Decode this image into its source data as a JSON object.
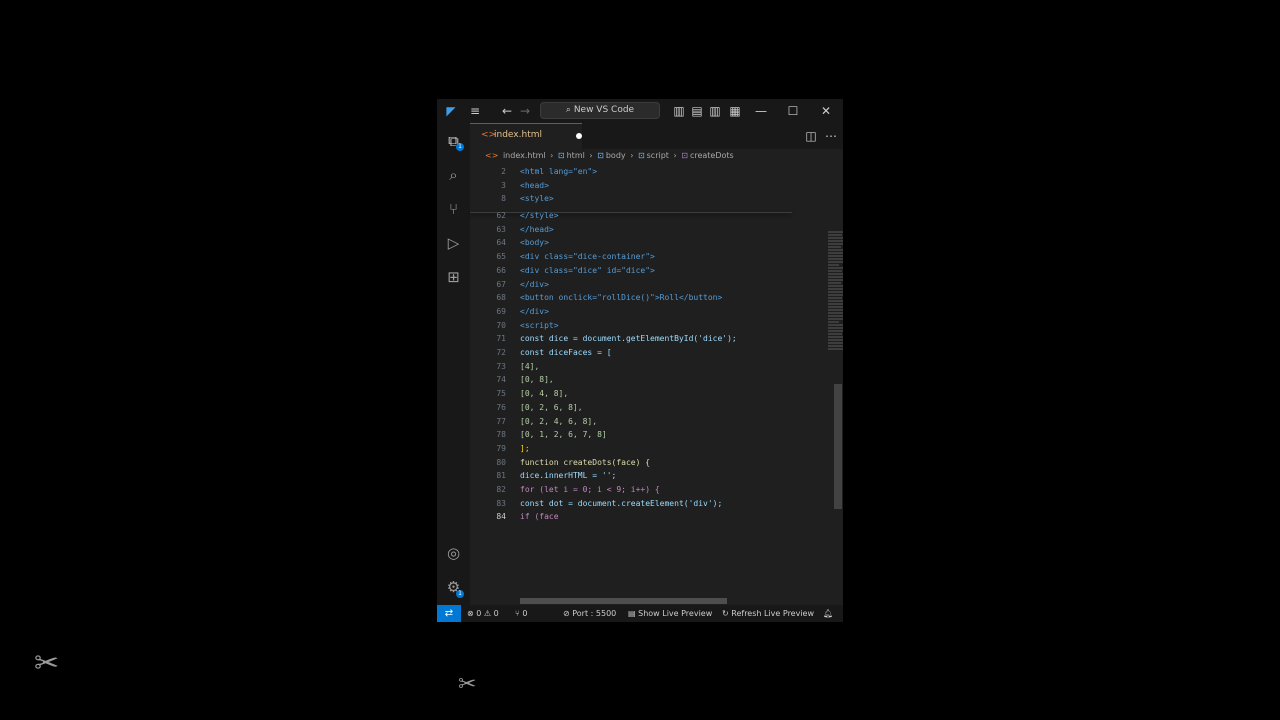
{
  "titlebar": {
    "search_label": "New VS Code"
  },
  "tab": {
    "label": "index.html"
  },
  "breadcrumb": [
    "index.html",
    "html",
    "body",
    "script",
    "createDots"
  ],
  "sticky_lines": [
    {
      "n": "2",
      "t": "<html lang=\"en\">"
    },
    {
      "n": "3",
      "t": "<head>"
    },
    {
      "n": "8",
      "t": "<style>"
    }
  ],
  "code_lines": [
    {
      "n": "62",
      "t": "</style>"
    },
    {
      "n": "63",
      "t": "</head>"
    },
    {
      "n": "64",
      "t": "<body>"
    },
    {
      "n": "65",
      "t": "<div class=\"dice-container\">"
    },
    {
      "n": "66",
      "t": "<div class=\"dice\" id=\"dice\">"
    },
    {
      "n": "67",
      "t": "</div>"
    },
    {
      "n": "68",
      "t": "<button onclick=\"rollDice()\">Roll</button>"
    },
    {
      "n": "69",
      "t": "</div>"
    },
    {
      "n": "70",
      "t": "<script>"
    },
    {
      "n": "71",
      "t": "const dice = document.getElementById('dice');"
    },
    {
      "n": "72",
      "t": "const diceFaces = ["
    },
    {
      "n": "73",
      "t": "[4],"
    },
    {
      "n": "74",
      "t": "[0, 8],"
    },
    {
      "n": "75",
      "t": "[0, 4, 8],"
    },
    {
      "n": "76",
      "t": "[0, 2, 6, 8],"
    },
    {
      "n": "77",
      "t": "[0, 2, 4, 6, 8],"
    },
    {
      "n": "78",
      "t": "[0, 1, 2, 6, 7, 8]"
    },
    {
      "n": "79",
      "t": "];"
    },
    {
      "n": "80",
      "t": "function createDots(face) {"
    },
    {
      "n": "81",
      "t": "dice.innerHTML = '';"
    },
    {
      "n": "82",
      "t": "for (let i = 0; i < 9; i++) {"
    },
    {
      "n": "83",
      "t": "const dot = document.createElement('div');"
    },
    {
      "n": "84",
      "t": "if (face"
    }
  ],
  "status": {
    "errors": "0",
    "warnings": "0",
    "ports": "0",
    "port": "Port : 5500",
    "show_preview": "Show Live Preview",
    "refresh_preview": "Refresh Live Preview"
  }
}
